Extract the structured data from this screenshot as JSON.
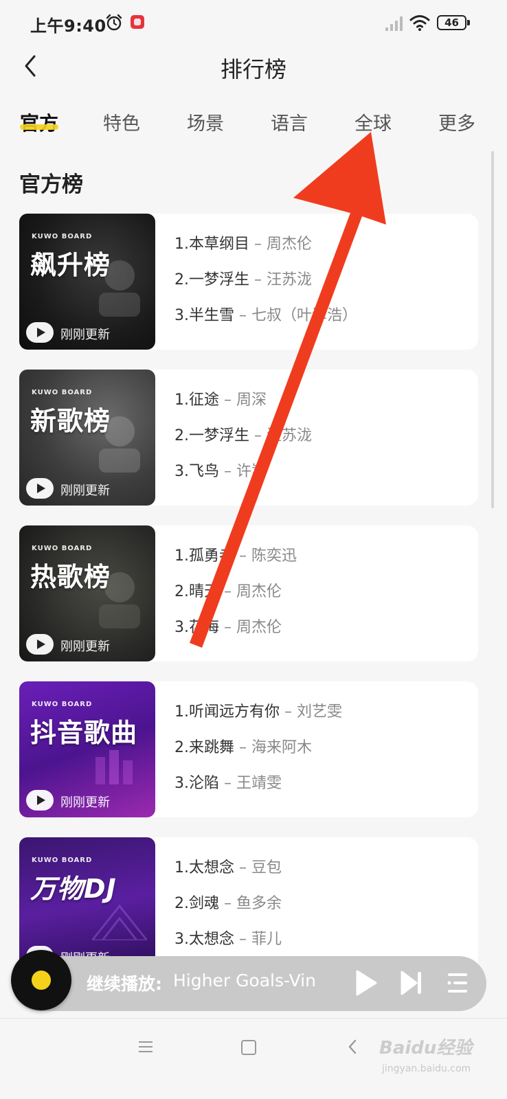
{
  "status_bar": {
    "time": "上午9:40",
    "battery": "46"
  },
  "header": {
    "title": "排行榜"
  },
  "tabs": [
    {
      "label": "官方",
      "active": true
    },
    {
      "label": "特色"
    },
    {
      "label": "场景"
    },
    {
      "label": "语言"
    },
    {
      "label": "全球"
    },
    {
      "label": "更多"
    }
  ],
  "section": {
    "title": "官方榜"
  },
  "charts": [
    {
      "brand": "KUWO BOARD",
      "name": "飙升榜",
      "update": "刚刚更新",
      "cover_color": "dark",
      "tracks": [
        {
          "line": "1.本草纲目",
          "artist": " – 周杰伦"
        },
        {
          "line": "2.一梦浮生",
          "artist": " – 汪苏泷"
        },
        {
          "line": "3.半生雪",
          "artist": " – 七叔（叶泽浩）"
        }
      ]
    },
    {
      "brand": "KUWO BOARD",
      "name": "新歌榜",
      "update": "刚刚更新",
      "cover_color": "gray",
      "tracks": [
        {
          "line": "1.征途",
          "artist": " – 周深"
        },
        {
          "line": "2.一梦浮生",
          "artist": " – 汪苏泷"
        },
        {
          "line": "3.飞鸟",
          "artist": " – 许嵩"
        }
      ]
    },
    {
      "brand": "KUWO BOARD",
      "name": "热歌榜",
      "update": "刚刚更新",
      "cover_color": "dark",
      "tracks": [
        {
          "line": "1.孤勇者",
          "artist": " – 陈奕迅"
        },
        {
          "line": "2.晴天",
          "artist": " – 周杰伦"
        },
        {
          "line": "3.花海",
          "artist": " – 周杰伦"
        }
      ]
    },
    {
      "brand": "KUWO BOARD",
      "name": "抖音歌曲",
      "update": "刚刚更新",
      "cover_color": "purple",
      "tracks": [
        {
          "line": "1.听闻远方有你",
          "artist": " – 刘艺雯"
        },
        {
          "line": "2.来跳舞",
          "artist": " – 海来阿木"
        },
        {
          "line": "3.沦陷",
          "artist": " – 王靖雯"
        }
      ]
    },
    {
      "brand": "KUWO BOARD",
      "name": "万物DJ",
      "update": "刚刚更新",
      "cover_color": "purple",
      "tracks": [
        {
          "line": "1.太想念",
          "artist": " – 豆包"
        },
        {
          "line": "2.剑魂",
          "artist": " – 鱼多余"
        },
        {
          "line": "3.太想念",
          "artist": " – 菲儿"
        }
      ]
    }
  ],
  "player": {
    "label": "继续播放:",
    "song": "Higher Goals-Vin"
  },
  "watermark": {
    "brand": "Baidu经验",
    "sub": "jingyan.baidu.com"
  },
  "colors": {
    "accent": "#f5d21a",
    "annotation_arrow": "#f03c1e"
  }
}
